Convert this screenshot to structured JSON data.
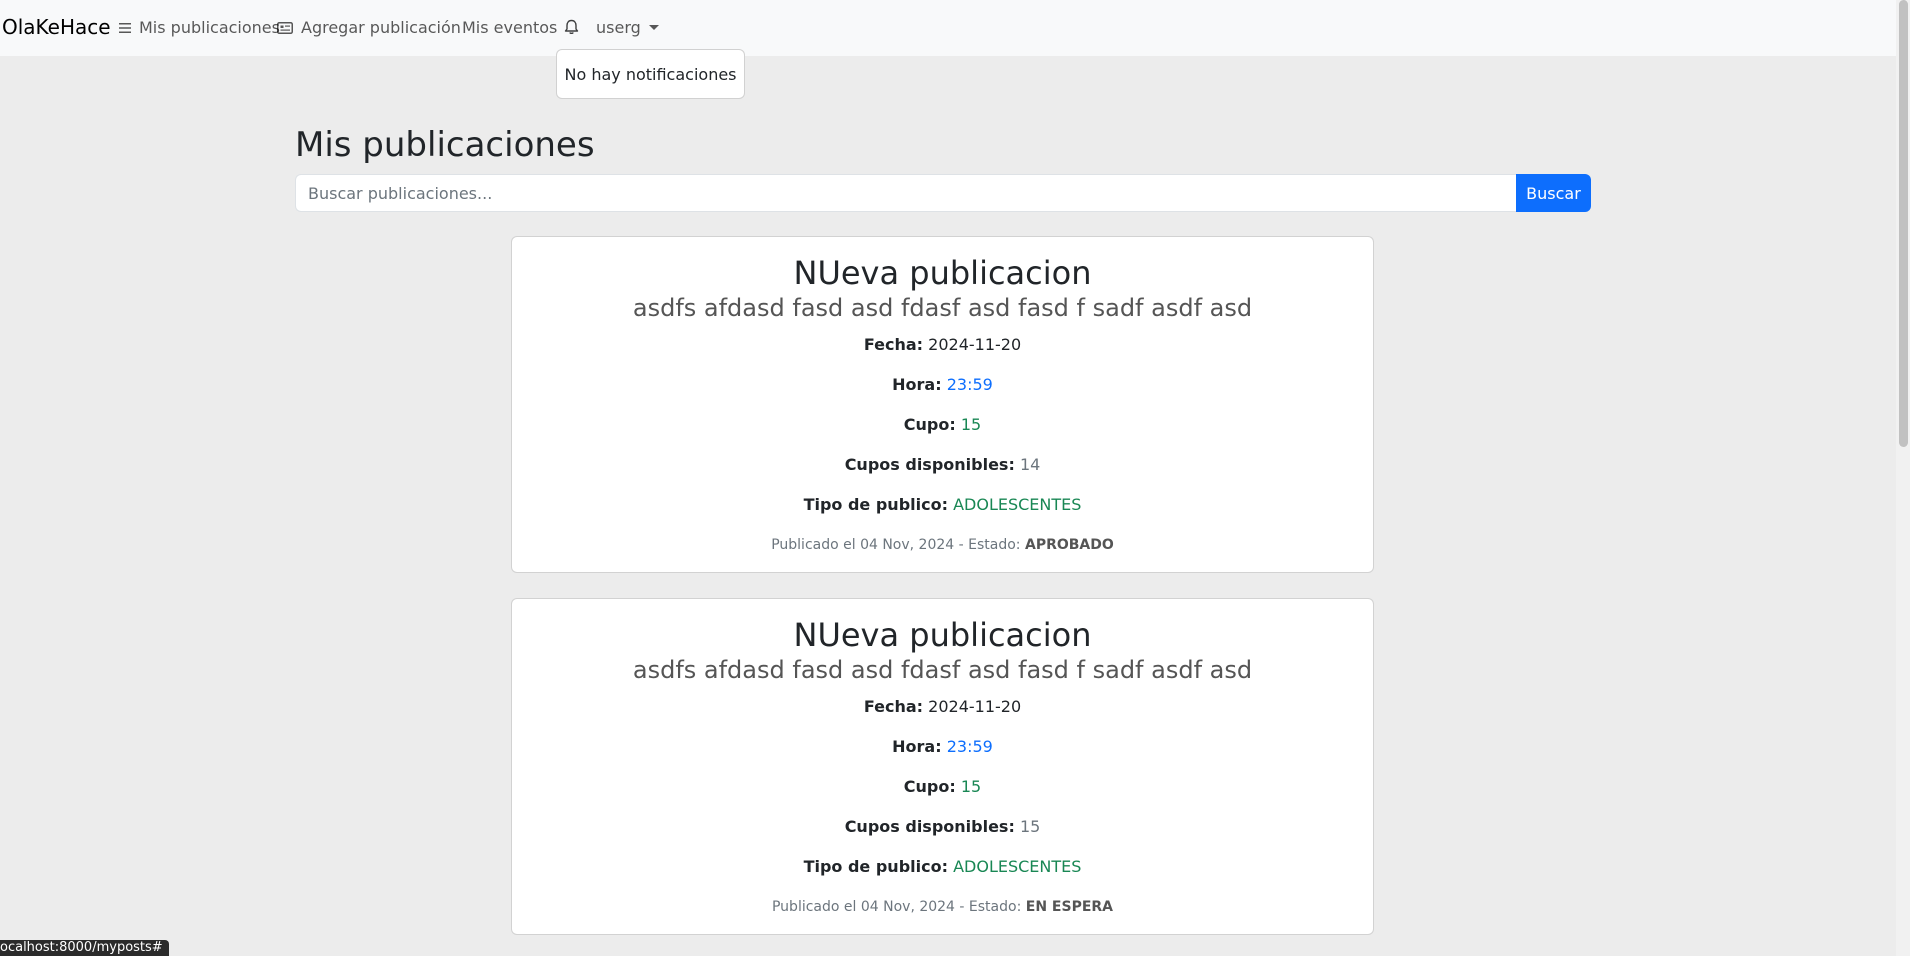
{
  "navbar": {
    "brand": "OlaKeHace",
    "items": [
      {
        "label": "Mis publicaciones",
        "icon": "list-icon"
      },
      {
        "label": "Agregar publicación",
        "icon": "newspaper-icon"
      },
      {
        "label": "Mis eventos"
      },
      {
        "label": "",
        "icon": "bell-icon"
      },
      {
        "label": "userg",
        "icon": "chevron-down-icon"
      }
    ]
  },
  "notifications": {
    "empty_text": "No hay notificaciones"
  },
  "page": {
    "title": "Mis publicaciones"
  },
  "search": {
    "placeholder": "Buscar publicaciones...",
    "button_label": "Buscar"
  },
  "labels": {
    "fecha": "Fecha:",
    "hora": "Hora:",
    "cupo": "Cupo:",
    "cupos_disponibles": "Cupos disponibles:",
    "tipo_publico": "Tipo de publico:",
    "estado": "Estado:"
  },
  "posts": [
    {
      "title": "NUeva publicacion",
      "subtitle": "asdfs afdasd fasd asd fdasf asd fasd f sadf asdf asd",
      "fecha": "2024-11-20",
      "hora": "23:59",
      "cupo": "15",
      "cupos_disponibles": "14",
      "tipo_publico": "ADOLESCENTES",
      "publicado": "Publicado el 04 Nov, 2024",
      "estado": "APROBADO"
    },
    {
      "title": "NUeva publicacion",
      "subtitle": "asdfs afdasd fasd asd fdasf asd fasd f sadf asdf asd",
      "fecha": "2024-11-20",
      "hora": "23:59",
      "cupo": "15",
      "cupos_disponibles": "15",
      "tipo_publico": "ADOLESCENTES",
      "publicado": "Publicado el 04 Nov, 2024",
      "estado": "EN ESPERA"
    }
  ],
  "status_bar": {
    "url": "ocalhost:8000/myposts#"
  }
}
